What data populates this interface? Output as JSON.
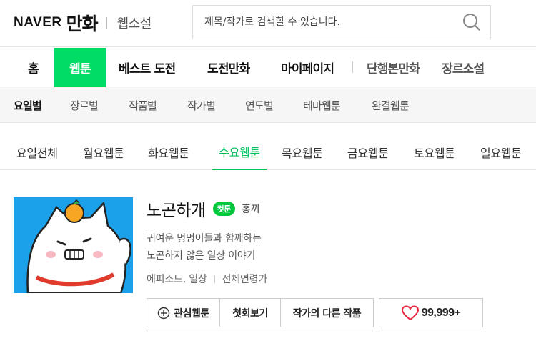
{
  "header": {
    "logo_naver": "NAVER",
    "logo_manhwa": "만화",
    "logo_novel": "웹소설",
    "search_placeholder": "제목/작가로 검색할 수 있습니다."
  },
  "mainnav": {
    "items": [
      "홈",
      "웹툰",
      "베스트 도전",
      "도전만화",
      "마이페이지",
      "단행본만화",
      "장르소설"
    ],
    "active": "웹툰"
  },
  "subnav": {
    "items": [
      "요일별",
      "장르별",
      "작품별",
      "작가별",
      "연도별",
      "테마웹툰",
      "완결웹툰"
    ],
    "active": "요일별"
  },
  "daytabs": {
    "items": [
      "요일전체",
      "월요웹툰",
      "화요웹툰",
      "수요웹툰",
      "목요웹툰",
      "금요웹툰",
      "토요웹툰",
      "일요웹툰"
    ],
    "active": "수요웹툰"
  },
  "webtoon": {
    "title": "노곤하개",
    "badge": "컷툰",
    "author": "홍끼",
    "description_line1": "귀여운 멍멍이들과 함께하는",
    "description_line2": "노곤하지 않은 일상 이야기",
    "genre": "에피소드, 일상",
    "age": "전체연령가",
    "buttons": {
      "interest": "관심웹툰",
      "first_episode": "첫회보기",
      "author_other": "작가의 다른 작품",
      "likes": "99,999+"
    }
  },
  "colors": {
    "accent": "#00dc64",
    "badge": "#00c73c",
    "active_tab": "#00c35b",
    "thumbnail_bg": "#1ba0ea",
    "heart": "#e8253f"
  }
}
